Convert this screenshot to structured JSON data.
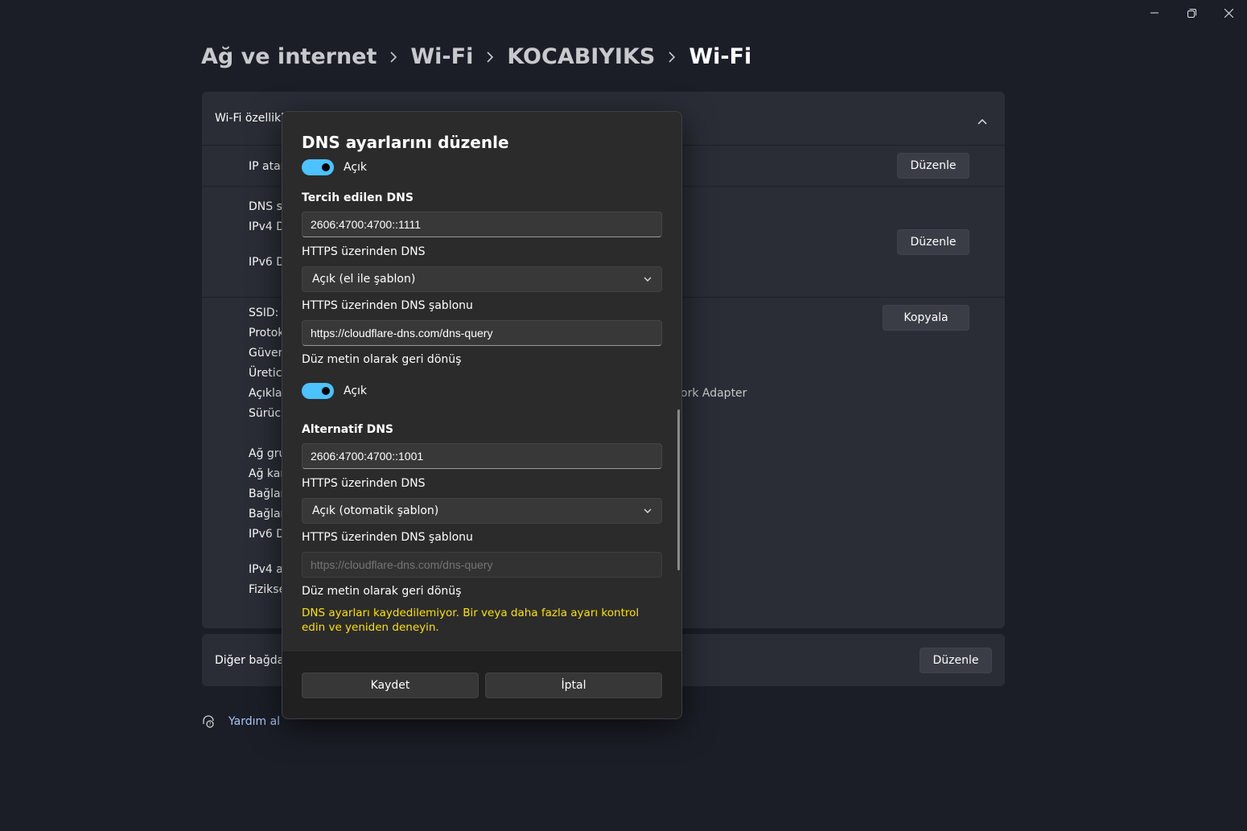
{
  "breadcrumb": [
    "Ağ ve internet",
    "Wi-Fi",
    "KOCABIYIKS",
    "Wi-Fi"
  ],
  "background": {
    "section_title": "Wi-Fi özellikle",
    "ip_row_label": "IP atan",
    "dns_rows": [
      "DNS su",
      "IPv4 D",
      "IPv6 D"
    ],
    "props": [
      "SSID:",
      "Protok",
      "Güvenl",
      "Üretici:",
      "Açıklam",
      "Sürücü",
      "Ağ gru",
      "Ağ kan",
      "Bağlan",
      "Bağlan",
      "IPv6 D",
      "IPv4 ac",
      "Fiziksel"
    ],
    "adapter_fragment": "ork Adapter",
    "edit_label": "Düzenle",
    "copy_label": "Kopyala",
    "other_label": "Diğer bağdaş"
  },
  "help": {
    "label": "Yardım al"
  },
  "dialog": {
    "title": "DNS ayarlarını düzenle",
    "toggle_on_label": "Açık",
    "preferred": {
      "heading": "Tercih edilen DNS",
      "address": "2606:4700:4700::1111",
      "https_label": "HTTPS üzerinden DNS",
      "https_value": "Açık (el ile şablon)",
      "template_label": "HTTPS üzerinden DNS şablonu",
      "template_value": "https://cloudflare-dns.com/dns-query",
      "fallback_label": "Düz metin olarak geri dönüş"
    },
    "alternate": {
      "heading": "Alternatif DNS",
      "address": "2606:4700:4700::1001",
      "https_label": "HTTPS üzerinden DNS",
      "https_value": "Açık (otomatik şablon)",
      "template_label": "HTTPS üzerinden DNS şablonu",
      "template_value": "https://cloudflare-dns.com/dns-query",
      "fallback_label": "Düz metin olarak geri dönüş"
    },
    "error": "DNS ayarları kaydedilemiyor. Bir veya daha fazla ayarı kontrol edin ve yeniden deneyin.",
    "save_label": "Kaydet",
    "cancel_label": "İptal"
  }
}
